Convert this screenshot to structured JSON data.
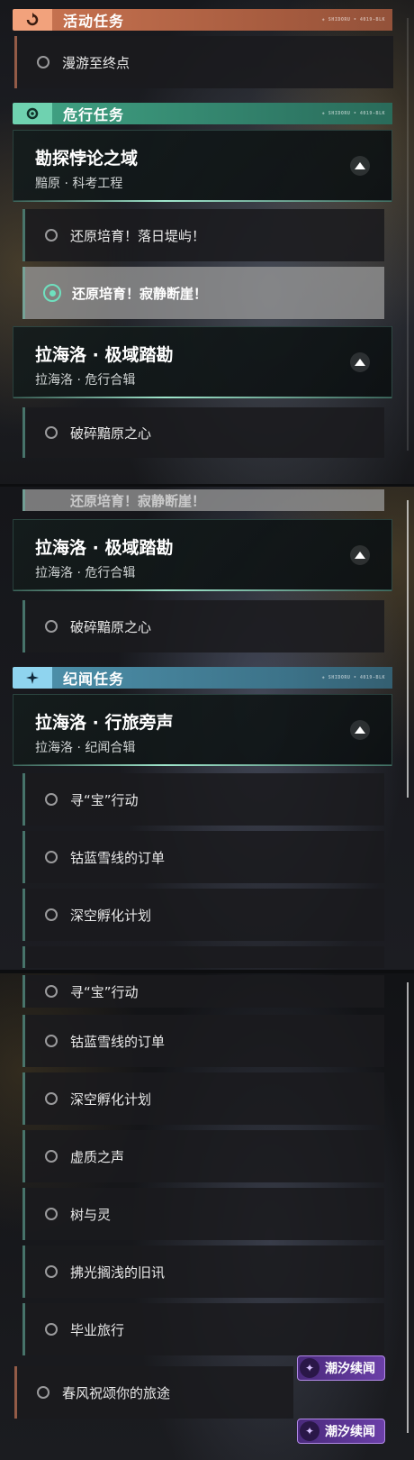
{
  "sections": {
    "activity": {
      "label": "活动任务"
    },
    "danger": {
      "label": "危行任务"
    },
    "chronicle": {
      "label": "纪闻任务"
    }
  },
  "section_tag": "◈ SHIDORU • 4019-BLK",
  "activity_item": "漫游至终点",
  "cards": {
    "paradox": {
      "title": "勘探悖论之域",
      "subtitle": "黯原 · 科考工程"
    },
    "rahailuo": {
      "title": "拉海洛 · 极域踏勘",
      "subtitle": "拉海洛 · 危行合辑"
    },
    "rahailuo2": {
      "title": "拉海洛 · 极域踏勘",
      "subtitle": "拉海洛 · 危行合辑"
    },
    "travel": {
      "title": "拉海洛 · 行旅旁声",
      "subtitle": "拉海洛 · 纪闻合辑"
    }
  },
  "danger_items": [
    "还原培育！落日堤屿！",
    "还原培育！寂静断崖！"
  ],
  "shatter_item": "破碎黯原之心",
  "shatter_item2": "破碎黯原之心",
  "partial_item": "还原培育！寂静断崖！",
  "travel_items": [
    "寻“宝”行动",
    "钴蓝雪线的订单",
    "深空孵化计划"
  ],
  "travel_items_full": [
    "寻“宝”行动",
    "钴蓝雪线的订单",
    "深空孵化计划",
    "虚质之声",
    "树与灵",
    "拂光搁浅的旧讯",
    "毕业旅行"
  ],
  "final_item": "春风祝颂你的旅途",
  "watermark": "潮汐续闻",
  "icons": {
    "activity": "activity-icon",
    "danger": "gear-icon",
    "chronicle": "star-icon",
    "expand": "triangle-up-icon"
  }
}
